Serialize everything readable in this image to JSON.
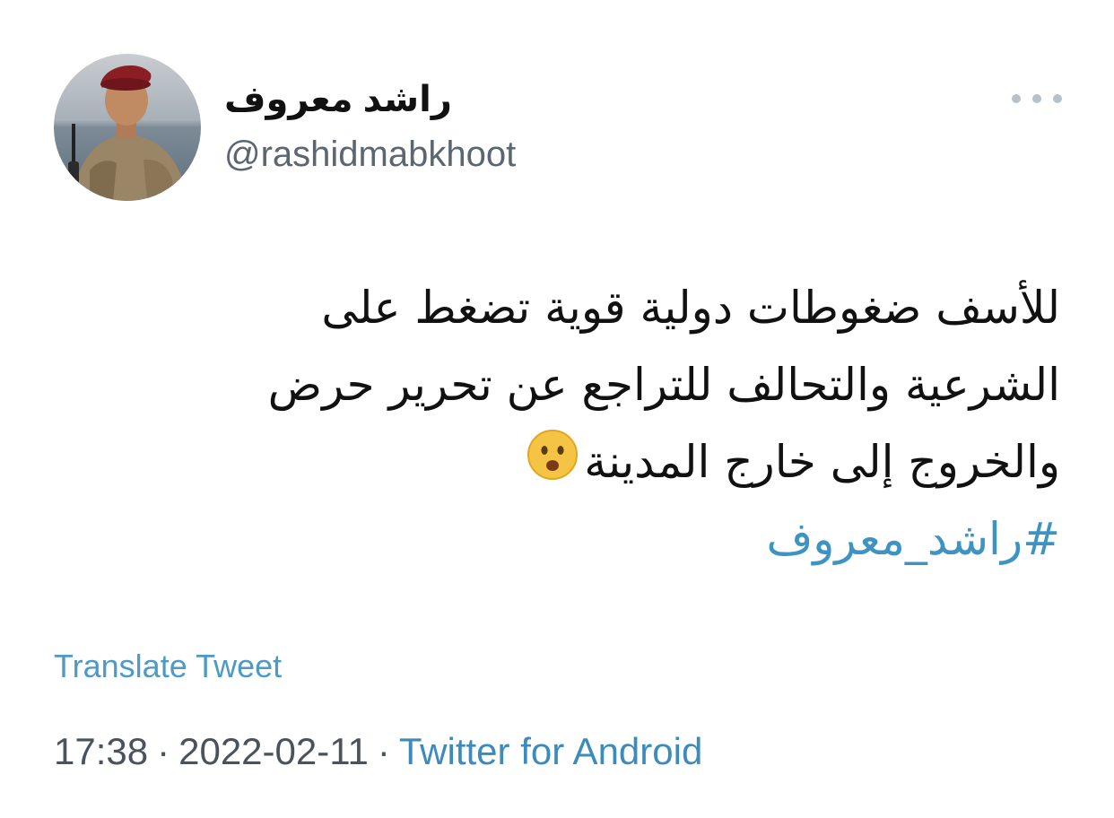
{
  "user": {
    "display_name": "راشد معروف",
    "handle": "@rashidmabkhoot",
    "avatar_icon": "profile-photo"
  },
  "more_icon": "ellipsis-icon",
  "tweet": {
    "lines": [
      "للأسف ضغوطات دولية قوية تضغط على",
      "الشرعية والتحالف  للتراجع عن تحرير حرض",
      "والخروج إلى خارج المدينة"
    ],
    "emoji": "😦",
    "hashtag": "#راشد_معروف"
  },
  "translate_label": "Translate Tweet",
  "meta": {
    "time": "17:38",
    "separator": "·",
    "date": "2022-02-11",
    "source": "Twitter for Android"
  },
  "colors": {
    "link": "#3d93c2",
    "text": "#111111",
    "muted": "#5b6670"
  }
}
